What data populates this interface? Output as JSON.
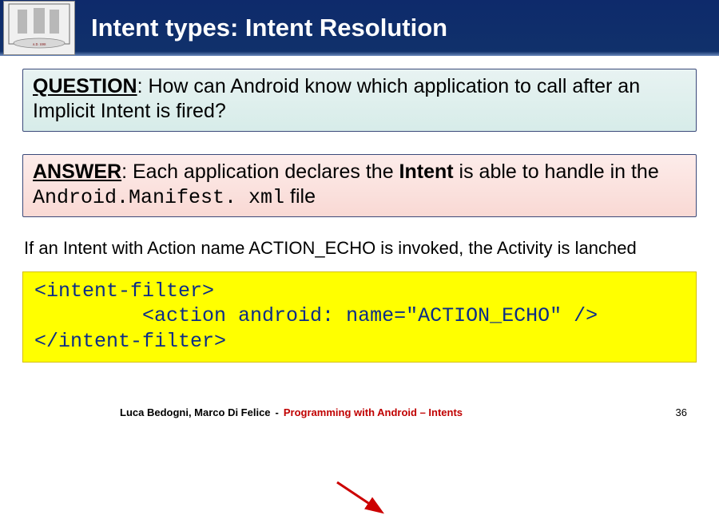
{
  "header": {
    "title_prefix": "Intent ",
    "title_types": "types:",
    "title_suffix": " Intent Resolution"
  },
  "question": {
    "label": "QUESTION",
    "text": ": How can Android know which application to call after an Implicit Intent is fired?"
  },
  "answer": {
    "label": "ANSWER",
    "text_before_bold": ": Each application declares the ",
    "bold_word": "Intent",
    "text_mid": " is able to handle in the ",
    "code_word": "Android.Manifest. xml",
    "text_after": " file"
  },
  "mid_sentence": "If an Intent with Action name ACTION_ECHO is invoked, the Activity is lanched",
  "code": {
    "line1": "<intent-filter>",
    "line2": "         <action android: name=\"ACTION_ECHO\" />",
    "line3": "</intent-filter>"
  },
  "footer": {
    "authors": "Luca Bedogni, Marco Di Felice",
    "dash": "-",
    "course": "Programming with Android – Intents",
    "page": "36"
  }
}
